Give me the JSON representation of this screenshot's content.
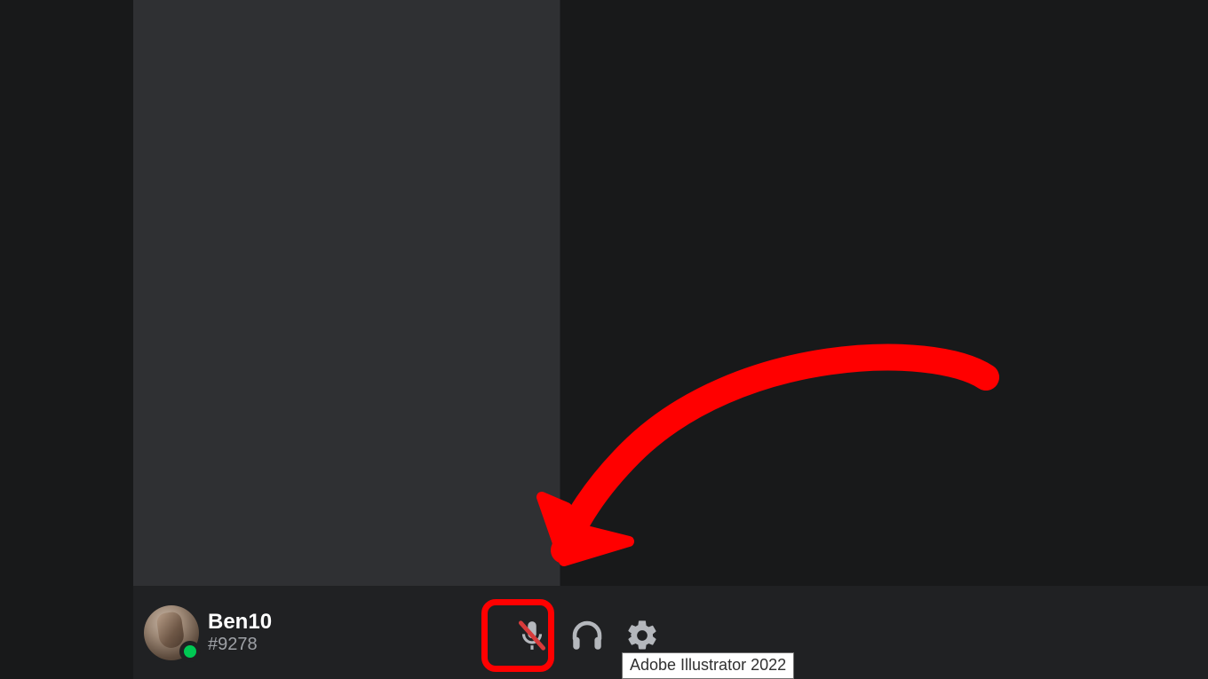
{
  "user_panel": {
    "username": "Ben10",
    "discriminator": "#9278",
    "status_color": "#00c853",
    "icons": {
      "mic": "microphone-muted-icon",
      "headphones": "headphones-icon",
      "settings": "gear-icon"
    }
  },
  "tooltip_text": "Adobe Illustrator 2022",
  "annotation": {
    "highlight_color": "#ff0000",
    "arrow_color": "#ff0000"
  }
}
